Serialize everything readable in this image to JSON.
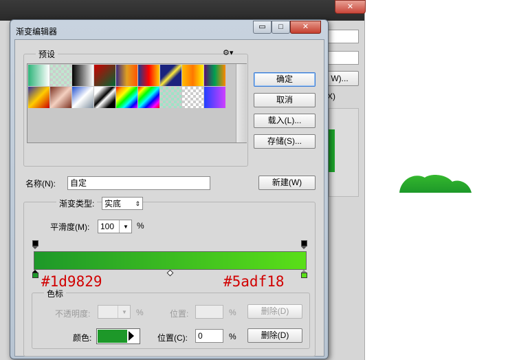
{
  "dialog": {
    "title": "渐变编辑器",
    "caption_minimize": "▭",
    "caption_maximize": "□",
    "caption_close": "✕"
  },
  "presets": {
    "legend": "预设",
    "gear_icon": "⚙▾",
    "swatches_row1": [
      "linear-gradient(90deg,#2fb47a,#ffffff)",
      "chk-green",
      "linear-gradient(90deg,#000000,#ffffff)",
      "linear-gradient(135deg,#cc0000,#006633)",
      "linear-gradient(90deg,#3a2a80,#e0a020,#ff5500)",
      "linear-gradient(90deg,#1a3a90,#ff0000,#ffcc00)",
      "linear-gradient(135deg,#1a237e 35%,#ffeb3b 50%,#1a237e 65%)",
      "linear-gradient(90deg,#ffbb00,#ff7700,#ffee00)",
      "linear-gradient(90deg,#5a1070,#00a050,#ff8800)"
    ],
    "swatches_row2": [
      "linear-gradient(135deg,#3030a0,#ffcc00,#cc0000)",
      "linear-gradient(135deg,#7a3020,#f4d0c0,#7a3020)",
      "linear-gradient(135deg,#2050d0,#ffffff,#8090a0)",
      "linear-gradient(135deg,#ffffff 20%,#000 45%,#ffffff 55%,#000 80%)",
      "linear-gradient(135deg,red,orange,yellow,lime,cyan,blue,magenta)",
      "linear-gradient(135deg,red,yellow,lime,cyan,blue,magenta,red)",
      "chk-teal",
      "chk",
      "linear-gradient(90deg,#2040ff,#d040ff)"
    ]
  },
  "buttons": {
    "ok": "确定",
    "cancel": "取消",
    "load": "载入(L)...",
    "save": "存储(S)...",
    "new": "新建(W)",
    "delete_opacity": "删除(D)",
    "delete_color": "删除(D)"
  },
  "name": {
    "label": "名称(N):",
    "value": "自定"
  },
  "gradient_type": {
    "label": "渐变类型:",
    "value": "实底"
  },
  "smoothness": {
    "label": "平滑度(M):",
    "value": "100",
    "unit": "%"
  },
  "gradient": {
    "start_color": "#1d9829",
    "end_color": "#5adf18",
    "start_hex_label": "#1d9829",
    "end_hex_label": "#5adf18"
  },
  "stops": {
    "legend": "色标",
    "opacity_label": "不透明度:",
    "opacity_unit": "%",
    "opacity_location_label": "位置:",
    "opacity_location_unit": "%",
    "color_label": "颜色:",
    "color_swatch": "#1d9829",
    "color_location_label": "位置(C):",
    "color_location_value": "0",
    "color_location_unit": "%"
  },
  "background_app": {
    "close_glyph": "✕",
    "button_w": "W)...",
    "text_x": "X)"
  },
  "preview_shape_color": "#1d9829"
}
